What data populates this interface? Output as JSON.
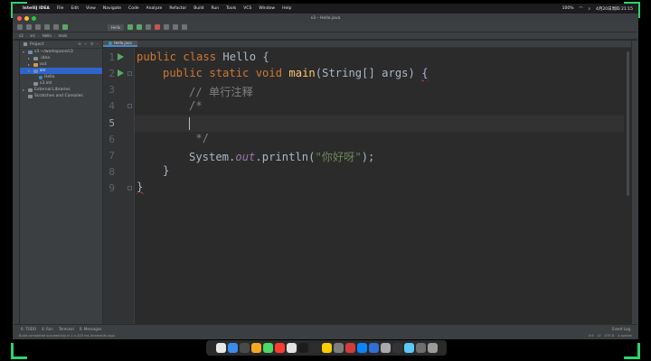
{
  "menubar": {
    "app_name": "IntelliJ IDEA",
    "items": [
      "File",
      "Edit",
      "View",
      "Navigate",
      "Code",
      "Analyze",
      "Refactor",
      "Build",
      "Run",
      "Tools",
      "VCS",
      "Window",
      "Help"
    ],
    "status_left": "100%",
    "status_right": "4月20日周四 21:15"
  },
  "window": {
    "title": "s3 – Hello.java"
  },
  "toolbar": {
    "run_config": "Hello"
  },
  "navbar": {
    "crumbs": [
      "s3",
      "src",
      "Hello",
      "main"
    ]
  },
  "project": {
    "header": "Project",
    "tree": [
      {
        "label": "s3 ~/workspace/s3",
        "kind": "folder-blue",
        "arrow": "▾",
        "indent": 0,
        "selected": false
      },
      {
        "label": ".idea",
        "kind": "folder-gray",
        "arrow": "▸",
        "indent": 1,
        "selected": false
      },
      {
        "label": "out",
        "kind": "folder-orange",
        "arrow": "▸",
        "indent": 1,
        "selected": false
      },
      {
        "label": "src",
        "kind": "folder-blue",
        "arrow": "▾",
        "indent": 1,
        "selected": true
      },
      {
        "label": "Hello",
        "kind": "class",
        "arrow": "",
        "indent": 2,
        "selected": false
      },
      {
        "label": "s3.iml",
        "kind": "file",
        "arrow": "",
        "indent": 1,
        "selected": false
      },
      {
        "label": "External Libraries",
        "kind": "folder-gray",
        "arrow": "▸",
        "indent": 0,
        "selected": false
      },
      {
        "label": "Scratches and Consoles",
        "kind": "folder-gray",
        "arrow": "",
        "indent": 0,
        "selected": false
      }
    ]
  },
  "editor": {
    "tab": "Hello.java",
    "line_numbers": [
      "1",
      "2",
      "3",
      "4",
      "5",
      "6",
      "7",
      "8",
      "9"
    ],
    "code": {
      "l1_kw": "public class ",
      "l1_name": "Hello {",
      "l2_kw": "public static void ",
      "l2_fn": "main",
      "l2_rest": "(String[] args) ",
      "l2_brace": "{",
      "l3": "// 单行注释",
      "l4": "/*",
      "l6": " */",
      "l7_a": "System.",
      "l7_out": "out",
      "l7_b": ".println(",
      "l7_str": "\"你好呀\"",
      "l7_c": ");",
      "l8": "}",
      "l9": "}"
    }
  },
  "bottom_tools": {
    "items": [
      "6: TODO",
      "4: Run",
      "Terminal",
      "0: Messages"
    ],
    "event_log": "Event Log"
  },
  "statusbar": {
    "message": "Build completed successfully in 1 s 203 ms (moments ago)",
    "right": [
      "5:9",
      "LF",
      "UTF-8",
      "4 spaces"
    ]
  },
  "dock": {
    "icon_colors": [
      "#e8e8e8",
      "#3b8beb",
      "#4a4a4a",
      "#f5a623",
      "#4cd964",
      "#ff3b30",
      "#e2e2e2",
      "#1c1c1c",
      "#2d2d2d",
      "#ffcc00",
      "#7d7d7d",
      "#d43b3b",
      "#0a84ff",
      "#2f6fd6",
      "#aaaaaa",
      "#343434",
      "#5ac8fa",
      "#6e6e6e",
      "#9b9b9b"
    ]
  }
}
